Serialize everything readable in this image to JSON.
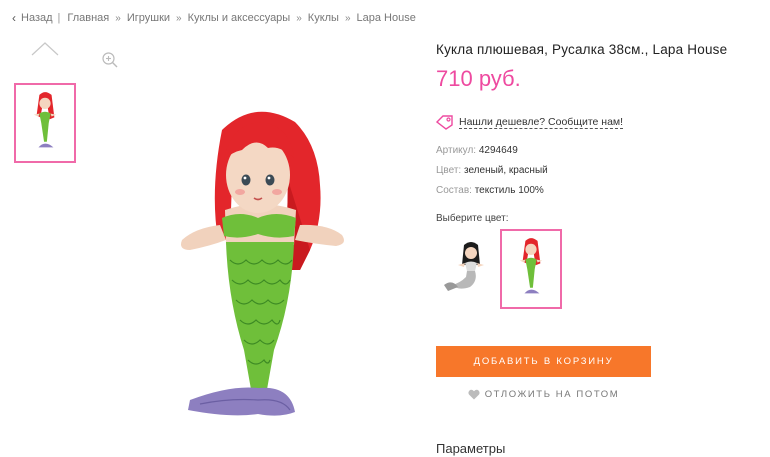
{
  "breadcrumb": {
    "back": "Назад",
    "items": [
      "Главная",
      "Игрушки",
      "Куклы и аксессуары",
      "Куклы",
      "Lapa House"
    ]
  },
  "product": {
    "title": "Кукла плюшевая, Русалка 38см., Lapa House",
    "price": "710 руб.",
    "cheaper_link": "Нашли дешевле? Сообщите нам!",
    "props": [
      {
        "key": "Артикул:",
        "value": "4294649"
      },
      {
        "key": "Цвет:",
        "value": "зеленый, красный"
      },
      {
        "key": "Состав:",
        "value": "текстиль 100%"
      }
    ],
    "choose_color_label": "Выберите цвет:",
    "variants": [
      "black-haired-mermaid",
      "red-haired-mermaid"
    ],
    "selected_variant": 1
  },
  "actions": {
    "add_to_cart": "ДОБАВИТЬ В КОРЗИНУ",
    "save_for_later": "ОТЛОЖИТЬ НА ПОТОМ"
  },
  "sections": {
    "params_title": "Параметры"
  },
  "colors": {
    "accent_pink": "#ee4aa0",
    "button_orange": "#f7772a",
    "hair_red": "#e3262b",
    "tail_green": "#6fbf3a",
    "fin_purple": "#8d7fc0"
  },
  "icons": [
    "back-chevron-icon",
    "arrow-up-icon",
    "zoom-in-icon",
    "price-tag-icon",
    "heart-icon"
  ]
}
